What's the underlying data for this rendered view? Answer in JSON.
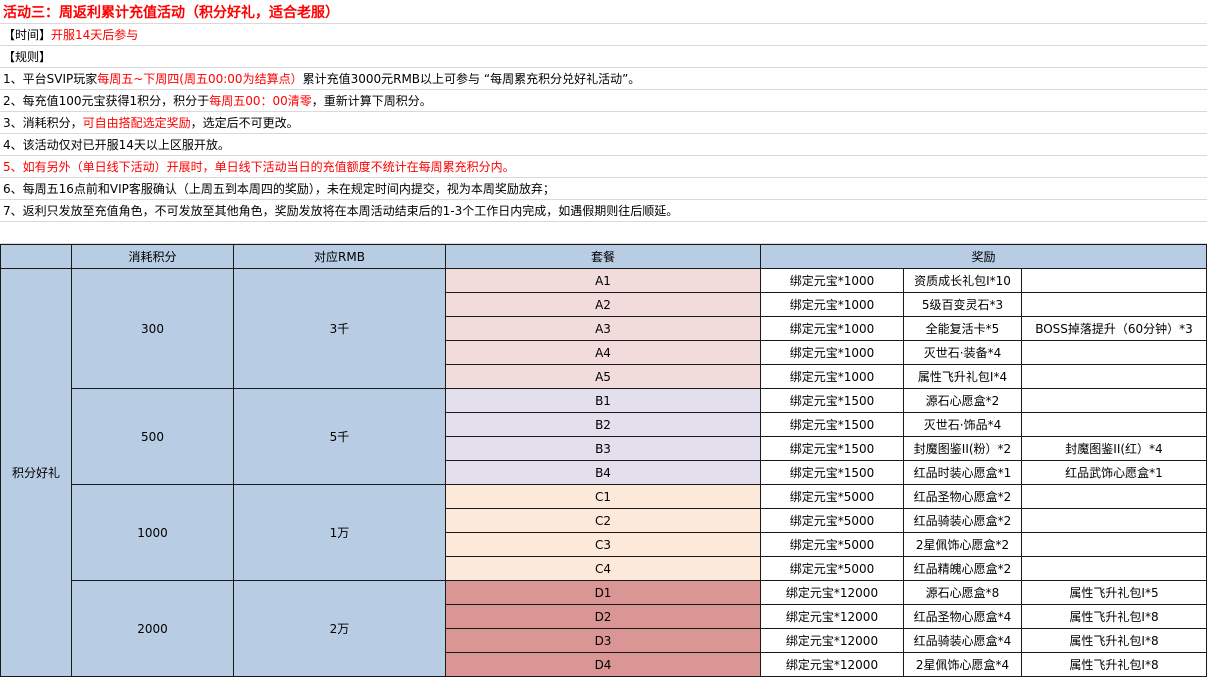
{
  "header": {
    "title": "活动三：周返利累计充值活动（积分好礼，适合老服）",
    "time_label": "【时间】",
    "time_value": "开服14天后参与",
    "rules_label": "【规则】"
  },
  "rules": [
    [
      {
        "t": "1、平台SVIP玩家"
      },
      {
        "t": "每周五~下周四(周五00:00为结算点）",
        "red": true
      },
      {
        "t": "累计充值3000元RMB以上可参与 “每周累充积分兑好礼活动”。"
      }
    ],
    [
      {
        "t": "2、每充值100元宝获得1积分，积分于"
      },
      {
        "t": "每周五00：00清零",
        "red": true
      },
      {
        "t": "，重新计算下周积分。"
      }
    ],
    [
      {
        "t": "3、消耗积分，"
      },
      {
        "t": "可自由搭配选定奖励",
        "red": true
      },
      {
        "t": "，选定后不可更改。"
      }
    ],
    [
      {
        "t": "4、该活动仅对已开服14天以上区服开放。"
      }
    ],
    [
      {
        "t": "5、如有另外（单日线下活动）开展时，单日线下活动当日的充值额度不统计在每周累充积分内。",
        "red": true
      }
    ],
    [
      {
        "t": "6、每周五16点前和VIP客服确认（上周五到本周四的奖励），未在规定时间内提交，视为本周奖励放弃；"
      }
    ],
    [
      {
        "t": "7、返利只发放至充值角色，不可发放至其他角色，奖励发放将在本周活动结束后的1-3个工作日内完成，如遇假期则往后顺延。"
      }
    ]
  ],
  "table": {
    "headers": [
      "消耗积分",
      "对应RMB",
      "套餐",
      "奖励"
    ],
    "category": "积分好礼",
    "groups": [
      {
        "points": "300",
        "rmb": "3千",
        "tint": "pa",
        "rows": [
          {
            "pkg": "A1",
            "r": [
              "绑定元宝*1000",
              "资质成长礼包I*10",
              ""
            ]
          },
          {
            "pkg": "A2",
            "r": [
              "绑定元宝*1000",
              "5级百变灵石*3",
              ""
            ]
          },
          {
            "pkg": "A3",
            "r": [
              "绑定元宝*1000",
              "全能复活卡*5",
              "BOSS掉落提升（60分钟）*3"
            ]
          },
          {
            "pkg": "A4",
            "r": [
              "绑定元宝*1000",
              "灭世石·装备*4",
              ""
            ]
          },
          {
            "pkg": "A5",
            "r": [
              "绑定元宝*1000",
              "属性飞升礼包I*4",
              ""
            ]
          }
        ]
      },
      {
        "points": "500",
        "rmb": "5千",
        "tint": "pb",
        "rows": [
          {
            "pkg": "B1",
            "r": [
              "绑定元宝*1500",
              "源石心愿盒*2",
              ""
            ]
          },
          {
            "pkg": "B2",
            "r": [
              "绑定元宝*1500",
              "灭世石·饰品*4",
              ""
            ]
          },
          {
            "pkg": "B3",
            "r": [
              "绑定元宝*1500",
              "封魔图鉴II(粉）*2",
              "封魔图鉴II(红）*4"
            ]
          },
          {
            "pkg": "B4",
            "r": [
              "绑定元宝*1500",
              "红品时装心愿盒*1",
              "红品武饰心愿盒*1"
            ]
          }
        ]
      },
      {
        "points": "1000",
        "rmb": "1万",
        "tint": "pc",
        "rows": [
          {
            "pkg": "C1",
            "r": [
              "绑定元宝*5000",
              "红品圣物心愿盒*2",
              ""
            ]
          },
          {
            "pkg": "C2",
            "r": [
              "绑定元宝*5000",
              "红品骑装心愿盒*2",
              ""
            ]
          },
          {
            "pkg": "C3",
            "r": [
              "绑定元宝*5000",
              "2星佩饰心愿盒*2",
              ""
            ]
          },
          {
            "pkg": "C4",
            "r": [
              "绑定元宝*5000",
              "红品精魄心愿盒*2",
              ""
            ]
          }
        ]
      },
      {
        "points": "2000",
        "rmb": "2万",
        "tint": "pd",
        "rows": [
          {
            "pkg": "D1",
            "r": [
              "绑定元宝*12000",
              "源石心愿盒*8",
              "属性飞升礼包I*5"
            ]
          },
          {
            "pkg": "D2",
            "r": [
              "绑定元宝*12000",
              "红品圣物心愿盒*4",
              "属性飞升礼包I*8"
            ]
          },
          {
            "pkg": "D3",
            "r": [
              "绑定元宝*12000",
              "红品骑装心愿盒*4",
              "属性飞升礼包I*8"
            ]
          },
          {
            "pkg": "D4",
            "r": [
              "绑定元宝*12000",
              "2星佩饰心愿盒*4",
              "属性飞升礼包I*8"
            ]
          }
        ]
      }
    ]
  }
}
